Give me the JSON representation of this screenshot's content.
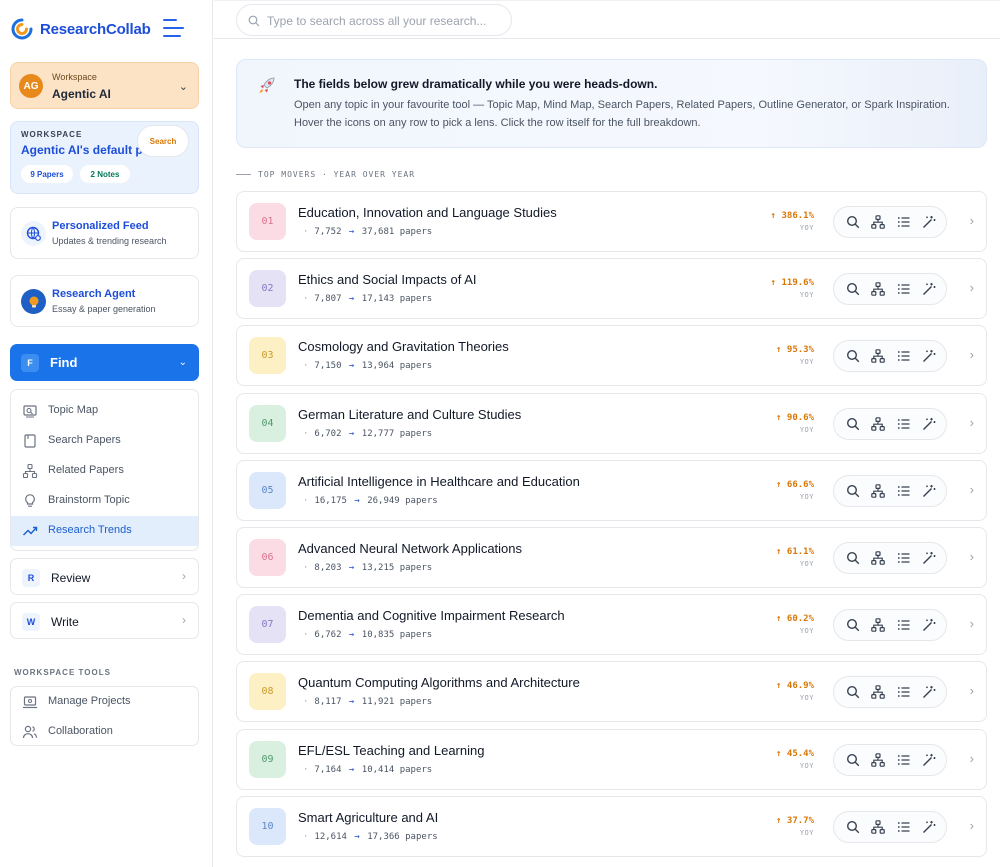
{
  "brand": {
    "name": "ResearchCollab"
  },
  "workspace": {
    "label": "Workspace",
    "name": "Agentic AI",
    "initials": "AG"
  },
  "project": {
    "label": "WORKSPACE",
    "title": "Agentic AI's default project",
    "chips": {
      "papers": "9 Papers",
      "notes": "2 Notes",
      "search": "Search"
    }
  },
  "feed": {
    "title": "Personalized Feed",
    "subtitle": "Updates & trending research"
  },
  "agent": {
    "title": "Research Agent",
    "subtitle": "Essay & paper generation"
  },
  "find": {
    "badge": "F",
    "label": "Find",
    "items": [
      {
        "label": "Topic Map"
      },
      {
        "label": "Search Papers"
      },
      {
        "label": "Related Papers"
      },
      {
        "label": "Brainstorm Topic"
      },
      {
        "label": "Research Trends"
      }
    ]
  },
  "review": {
    "badge": "R",
    "label": "Review"
  },
  "write": {
    "badge": "W",
    "label": "Write"
  },
  "tools": {
    "heading": "WORKSPACE TOOLS",
    "items": [
      {
        "label": "Manage Projects"
      },
      {
        "label": "Collaboration"
      }
    ]
  },
  "search": {
    "placeholder": "Type to search across all your research..."
  },
  "banner": {
    "title": "The fields below grew dramatically while you were heads-down.",
    "body": "Open any topic in your favourite tool — Topic Map, Mind Map, Search Papers, Related Papers, Outline Generator, or Spark Inspiration. Hover the icons on any row to pick a lens. Click the row itself for the full breakdown."
  },
  "movers_heading": "TOP MOVERS · YEAR OVER YEAR",
  "yoy_label": "YOY",
  "papers_word": "papers",
  "rows": [
    {
      "rank": "01",
      "title": "Education, Innovation and Language Studies",
      "from": "7,752",
      "to": "37,681",
      "growth": "↑ 386.1%",
      "bg": "#fbdbe4",
      "fg": "#d9738f"
    },
    {
      "rank": "02",
      "title": "Ethics and Social Impacts of AI",
      "from": "7,807",
      "to": "17,143",
      "growth": "↑ 119.6%",
      "bg": "#e6e2f6",
      "fg": "#8579c2"
    },
    {
      "rank": "03",
      "title": "Cosmology and Gravitation Theories",
      "from": "7,150",
      "to": "13,964",
      "growth": "↑ 95.3%",
      "bg": "#fdf0c4",
      "fg": "#c99a2b"
    },
    {
      "rank": "04",
      "title": "German Literature and Culture Studies",
      "from": "6,702",
      "to": "12,777",
      "growth": "↑ 90.6%",
      "bg": "#d9f0e1",
      "fg": "#4f9a6b"
    },
    {
      "rank": "05",
      "title": "Artificial Intelligence in Healthcare and Education",
      "from": "16,175",
      "to": "26,949",
      "growth": "↑ 66.6%",
      "bg": "#dbe8fb",
      "fg": "#5a86c8"
    },
    {
      "rank": "06",
      "title": "Advanced Neural Network Applications",
      "from": "8,203",
      "to": "13,215",
      "growth": "↑ 61.1%",
      "bg": "#fbdbe4",
      "fg": "#d9738f"
    },
    {
      "rank": "07",
      "title": "Dementia and Cognitive Impairment Research",
      "from": "6,762",
      "to": "10,835",
      "growth": "↑ 60.2%",
      "bg": "#e6e2f6",
      "fg": "#8579c2"
    },
    {
      "rank": "08",
      "title": "Quantum Computing Algorithms and Architecture",
      "from": "8,117",
      "to": "11,921",
      "growth": "↑ 46.9%",
      "bg": "#fdf0c4",
      "fg": "#c99a2b"
    },
    {
      "rank": "09",
      "title": "EFL/ESL Teaching and Learning",
      "from": "7,164",
      "to": "10,414",
      "growth": "↑ 45.4%",
      "bg": "#d9f0e1",
      "fg": "#4f9a6b"
    },
    {
      "rank": "10",
      "title": "Smart Agriculture and AI",
      "from": "12,614",
      "to": "17,366",
      "growth": "↑ 37.7%",
      "bg": "#dbe8fb",
      "fg": "#5a86c8"
    }
  ],
  "icons": {
    "logo": "researchcollab-logo-icon",
    "row_actions": [
      "search-icon",
      "mind-map-icon",
      "list-icon",
      "magic-wand-icon"
    ]
  },
  "colors": {
    "accent": "#1a73e8",
    "brand": "#1d4ed8",
    "growth": "#d97706",
    "workspace": "#fde3c6"
  }
}
